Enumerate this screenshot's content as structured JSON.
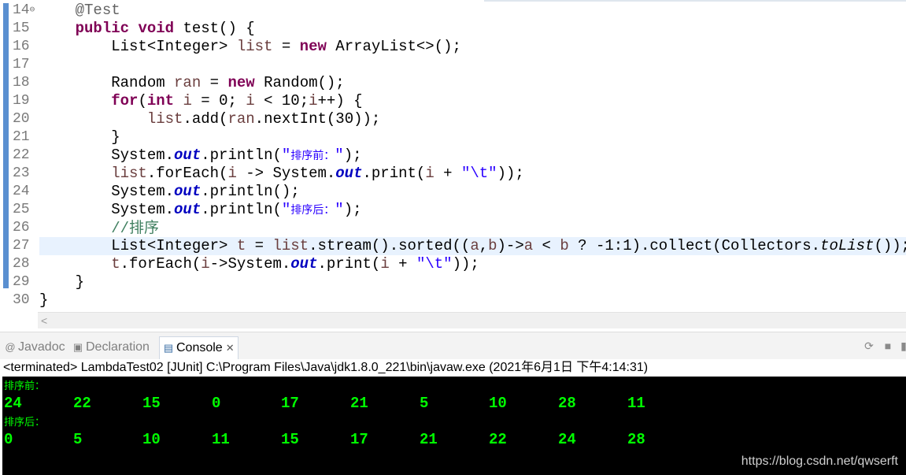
{
  "editor": {
    "line_numbers": [
      "14",
      "15",
      "16",
      "17",
      "18",
      "19",
      "20",
      "21",
      "22",
      "23",
      "24",
      "25",
      "26",
      "27",
      "28",
      "29",
      "30"
    ]
  },
  "tabs": {
    "javadoc": "Javadoc",
    "declaration": "Declaration",
    "console": "Console",
    "close_glyph": "✕"
  },
  "console": {
    "status": "<terminated> LambdaTest02 [JUnit] C:\\Program Files\\Java\\jdk1.8.0_221\\bin\\javaw.exe (2021年6月1日 下午4:14:31)",
    "before_label": "排序前：",
    "before_values": [
      "24",
      "22",
      "15",
      "0",
      "17",
      "21",
      "5",
      "10",
      "28",
      "11"
    ],
    "after_label": "排序后：",
    "after_values": [
      "0",
      "5",
      "10",
      "11",
      "15",
      "17",
      "21",
      "22",
      "24",
      "28"
    ],
    "watermark": "https://blog.csdn.net/qwserft"
  },
  "icons": {
    "fold": "⊖",
    "hscroll_left": "<",
    "javadoc": "@",
    "declaration": "▣",
    "console": "▤",
    "pin": "⟳",
    "minimize": "■",
    "maximize": "▮"
  }
}
